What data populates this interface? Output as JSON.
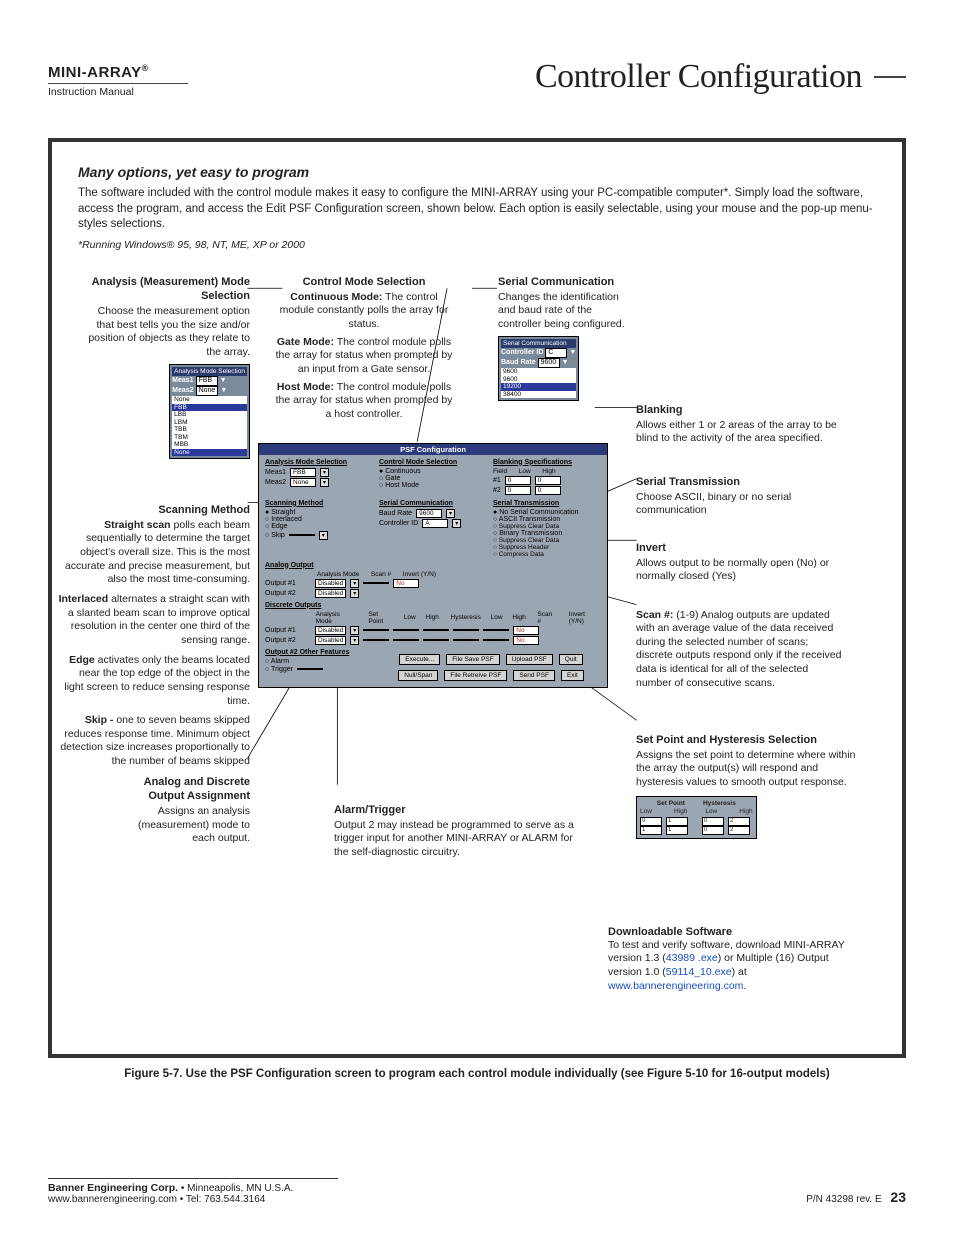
{
  "header": {
    "brand": "MINI-ARRAY",
    "reg": "®",
    "subtitle": "Instruction Manual",
    "section_title": "Controller Configuration"
  },
  "intro": {
    "heading": "Many options, yet easy to program",
    "body": "The software included with the control module makes it easy to configure the MINI-ARRAY using your PC-compatible computer*. Simply load the software, access the program, and access the Edit PSF Configuration screen, shown below. Each option is easily selectable, using your mouse and the pop-up menu-styles selections.",
    "footnote": "*Running Windows® 95, 98, NT, ME, XP or 2000"
  },
  "callouts": {
    "analysis": {
      "title": "Analysis (Measurement) Mode Selection",
      "body": "Choose the measurement option that best tells you the size and/or position of objects as they relate to the array.",
      "popup_header": "Analysis Mode Selection",
      "meas1": "Meas1",
      "meas1_val": "FBB",
      "meas2": "Meas2",
      "meas2_val": "None",
      "opts": [
        "None",
        "FBB",
        "LBB",
        "LBM",
        "TBB",
        "TBM",
        "MBB",
        "None"
      ]
    },
    "control": {
      "title": "Control Mode Selection",
      "l1b": "Continuous Mode:",
      "l1": " The control module constantly polls the array for status.",
      "l2b": "Gate Mode:",
      "l2": " The control module polls the array for status when prompted by an input from a Gate sensor.",
      "l3b": "Host Mode:",
      "l3": " The control module polls the array for status when prompted by a host controller."
    },
    "serial_comm": {
      "title": "Serial Communication",
      "body": "Changes the identification and baud rate of the controller being configured.",
      "popup_hdr": "Serial Communication",
      "cid": "Controller ID",
      "cid_val": "C",
      "baud": "Baud Rate",
      "baud_val": "9600",
      "baud_opts": [
        "9600",
        "9600",
        "19200",
        "38400"
      ]
    },
    "scanning": {
      "title": "Scanning Method",
      "p1b": "Straight scan",
      "p1": " polls each beam sequentially to determine the target object's overall size. This is the most accurate and precise measurement, but also the most time-consuming.",
      "p2b": "Interlaced",
      "p2": " alternates a straight scan with a slanted beam scan to improve optical resolution in the center one third of the sensing range.",
      "p3b": "Edge",
      "p3": " activates only the beams located near the top edge of the object in the light screen to reduce sensing response time.",
      "p4b": "Skip -",
      "p4": " one to seven beams skipped reduces response time. Minimum object detection size increases proportionally to the number of beams skipped"
    },
    "analog_discrete": {
      "title": "Analog and Discrete Output Assignment",
      "body": "Assigns an analysis (measurement) mode to each output."
    },
    "alarm": {
      "title": "Alarm/Trigger",
      "body": "Output 2 may instead be programmed to serve as a trigger input for another MINI-ARRAY or ALARM for the self-diagnostic circuitry."
    },
    "blanking": {
      "title": "Blanking",
      "body": "Allows either 1 or 2 areas of the array to be blind to the activity of the area specified."
    },
    "serial_trans": {
      "title": "Serial Transmission",
      "body": "Choose ASCII, binary or no serial communication"
    },
    "invert": {
      "title": "Invert",
      "body": "Allows output to be normally open (No) or normally closed (Yes)"
    },
    "scan_num": {
      "title": "Scan #:",
      "body": " (1-9) Analog outputs are updated with an average value of the data received during the selected number of scans; discrete outputs respond only if the received data is identical for all of the selected number of consecutive scans."
    },
    "setpoint": {
      "title": "Set Point and Hysteresis Selection",
      "body": "Assigns the set point to determine where within the array the output(s) will respond and hysteresis values to smooth output response.",
      "sp": "Set Point",
      "hy": "Hysteresis",
      "low": "Low",
      "high": "High",
      "r1": [
        "0",
        "1",
        "0",
        "2"
      ],
      "r2": [
        "1",
        "1",
        "0",
        "2"
      ]
    },
    "download": {
      "title": "Downloadable Software",
      "body1": "To test and verify software, download MINI-ARRAY version 1.3 (",
      "link1": "43989 .exe",
      "body2": ") or Multiple (16) Output version 1.0 (",
      "link2": "59114_10.exe",
      "body3": ") at ",
      "link3": "www.bannerengineering.com",
      "body4": "."
    }
  },
  "psf": {
    "title": "PSF Configuration",
    "ams": "Analysis Mode Selection",
    "meas1": "Meas1",
    "meas1_v": "FBB",
    "meas2": "Meas2",
    "meas2_v": "None",
    "cms": "Control Mode Selection",
    "cms_opts": [
      "Continuous",
      "Gate",
      "Host Mode"
    ],
    "blank": "Blanking Specifications",
    "field": "Field",
    "low": "Low",
    "high": "High",
    "n1": "#1",
    "n2": "#2",
    "zero": "0",
    "scan_method": "Scanning Method",
    "scan_opts": [
      "Straight",
      "Interlaced",
      "Edge",
      "Skip"
    ],
    "serial_comm": "Serial Communication",
    "baud": "Baud Rate",
    "baud_v": "9600",
    "cid": "Controller ID",
    "cid_v": "A",
    "serial_trans": "Serial Transmission",
    "st_opts": [
      "No Serial Communication",
      "ASCII Transmission",
      "Suppress Clear Data",
      "Binary Transmission",
      "Suppress Clear Data",
      "Suppress Header",
      "Compress Data"
    ],
    "analog_out": "Analog Output",
    "am": "Analysis Mode",
    "scan_n": "Scan #",
    "inv": "Invert (Y/N)",
    "out1": "Output #1",
    "out2": "Output #2",
    "dis": "Disabled",
    "no": "No",
    "disc_out": "Discrete Outputs",
    "sp": "Set Point",
    "hy": "Hysteresis",
    "other": "Output #2 Other Features",
    "alarm": "Alarm",
    "trigger": "Trigger",
    "btns1": [
      "Execute...",
      "File Save PSF",
      "Upload PSF",
      "Quit"
    ],
    "btns2": [
      "Null/Span",
      "File Retreive PSF",
      "Send PSF",
      "Exit"
    ]
  },
  "figure_caption": "Figure 5-7. Use the PSF Configuration screen to program each control module individually (see Figure 5-10 for 16-output models)",
  "footer": {
    "company": "Banner Engineering Corp.",
    "loc": " • Minneapolis, MN U.S.A.",
    "web": "www.bannerengineering.com  •  Tel: 763.544.3164",
    "pn": "P/N 43298 rev. E",
    "page": "23"
  }
}
